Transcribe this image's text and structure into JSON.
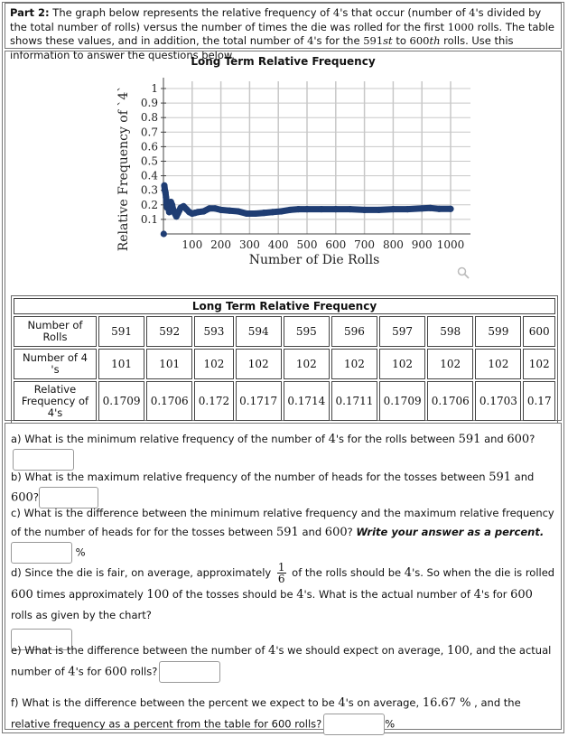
{
  "intro": {
    "part_label": "Part 2:",
    "text_1": " The graph below represents the relative frequency of ",
    "four": "4",
    "text_2": "'s that occur (number of ",
    "text_3": "'s divided by the total number of rolls) versus the number of times the die was rolled for the first ",
    "thousand": "1000",
    "text_4": " rolls. The table shows these values, and in addition, the total number of ",
    "text_5": "'s for the ",
    "n591": "591",
    "st": "st",
    "to": " to ",
    "n600": "600",
    "th": "th",
    "text_6": " rolls. Use this information to answer the questions below."
  },
  "chart_data": {
    "type": "scatter",
    "title": "Long Term Relative Frequency",
    "xlabel": "Number of Die Rolls",
    "ylabel": "Relative Frequency of `4`",
    "xlim": [
      0,
      1000
    ],
    "ylim": [
      0,
      1
    ],
    "grid": true,
    "xticks": [
      100,
      200,
      300,
      400,
      500,
      600,
      700,
      800,
      900,
      1000
    ],
    "yticks": [
      0.1,
      0.2,
      0.3,
      0.4,
      0.5,
      0.6,
      0.7,
      0.8,
      0.9,
      1
    ],
    "xtick_labels": [
      "100",
      "200",
      "300",
      "400",
      "500",
      "600",
      "700",
      "800",
      "900",
      "1000"
    ],
    "ytick_labels": [
      "0.1",
      "0.2",
      "0.3",
      "0.4",
      "0.5",
      "0.6",
      "0.7",
      "0.8",
      "0.9",
      "1"
    ],
    "color": "#1f3d73",
    "points": [
      [
        1,
        0.0
      ],
      [
        3,
        0.333
      ],
      [
        5,
        0.3
      ],
      [
        7,
        0.286
      ],
      [
        9,
        0.25
      ],
      [
        11,
        0.2
      ],
      [
        13,
        0.18
      ],
      [
        15,
        0.22
      ],
      [
        18,
        0.19
      ],
      [
        20,
        0.15
      ],
      [
        23,
        0.17
      ],
      [
        26,
        0.22
      ],
      [
        30,
        0.2
      ],
      [
        35,
        0.16
      ],
      [
        40,
        0.14
      ],
      [
        45,
        0.12
      ],
      [
        50,
        0.14
      ],
      [
        55,
        0.16
      ],
      [
        60,
        0.18
      ],
      [
        70,
        0.19
      ],
      [
        80,
        0.17
      ],
      [
        90,
        0.15
      ],
      [
        100,
        0.14
      ],
      [
        110,
        0.145
      ],
      [
        120,
        0.15
      ],
      [
        140,
        0.155
      ],
      [
        160,
        0.175
      ],
      [
        180,
        0.175
      ],
      [
        200,
        0.165
      ],
      [
        230,
        0.16
      ],
      [
        260,
        0.155
      ],
      [
        290,
        0.14
      ],
      [
        320,
        0.14
      ],
      [
        350,
        0.145
      ],
      [
        380,
        0.15
      ],
      [
        410,
        0.155
      ],
      [
        440,
        0.165
      ],
      [
        470,
        0.17
      ],
      [
        500,
        0.17
      ],
      [
        550,
        0.17
      ],
      [
        600,
        0.17
      ],
      [
        650,
        0.17
      ],
      [
        700,
        0.165
      ],
      [
        750,
        0.165
      ],
      [
        800,
        0.17
      ],
      [
        850,
        0.17
      ],
      [
        900,
        0.175
      ],
      [
        930,
        0.178
      ],
      [
        960,
        0.172
      ],
      [
        1000,
        0.172
      ]
    ]
  },
  "table": {
    "caption": "Long Term Relative Frequency",
    "row_headers": [
      "Number of Rolls",
      "Number of 4 's",
      "Relative Frequency of 4's"
    ],
    "rolls": [
      "591",
      "592",
      "593",
      "594",
      "595",
      "596",
      "597",
      "598",
      "599",
      "600"
    ],
    "fours": [
      "101",
      "101",
      "102",
      "102",
      "102",
      "102",
      "102",
      "102",
      "102",
      "102"
    ],
    "rel_freq": [
      "0.1709",
      "0.1706",
      "0.172",
      "0.1717",
      "0.1714",
      "0.1711",
      "0.1709",
      "0.1706",
      "0.1703",
      "0.17"
    ]
  },
  "questions": {
    "a": {
      "t1": "a) What is the minimum relative frequency of the number of ",
      "four": "4",
      "t2": "'s for the rolls between ",
      "n1": "591",
      "and": " and ",
      "n2": "600",
      "t3": "?",
      "value": ""
    },
    "b": {
      "t1": "b) What is the maximum relative frequency of the number of heads for the tosses between ",
      "n1": "591",
      "and": " and ",
      "n2": "600",
      "t3": "?",
      "value": ""
    },
    "c": {
      "t1": "c) What is the difference between the minimum relative frequency and the maximum relative frequency of the number of heads for for the tosses between ",
      "n1": "591",
      "and": " and ",
      "n2": "600",
      "t2": "? ",
      "emph": "Write your answer as a percent.",
      "unit": "%",
      "value": ""
    },
    "d": {
      "t1": "d) Since the die is fair, on average, approximately ",
      "frac_num": "1",
      "frac_den": "6",
      "t2": " of the rolls should be ",
      "four": "4",
      "t3": "'s. So when the die is rolled ",
      "n600": "600",
      "t4": " times approximately ",
      "n100": "100",
      "t5": " of the tosses should be ",
      "t6": "'s. What is the actual number of ",
      "t7": "'s for ",
      "t8": " rolls as given by the chart?",
      "value": ""
    },
    "e": {
      "t1": "e) What is the difference between the number of ",
      "four": "4",
      "t2": "'s we should expect on average, ",
      "n100": "100",
      "t3": ", and the actual number of ",
      "t4": "'s for ",
      "n600": "600",
      "t5": " rolls?",
      "value": ""
    },
    "f": {
      "t1": "f) What is the difference between the percent we expect to be ",
      "four": "4",
      "t2": "'s on average, ",
      "pct": "16.67 %",
      "t3": " , and the relative frequency as a percent from the table for 600 rolls?",
      "unit": "%",
      "value": ""
    }
  }
}
